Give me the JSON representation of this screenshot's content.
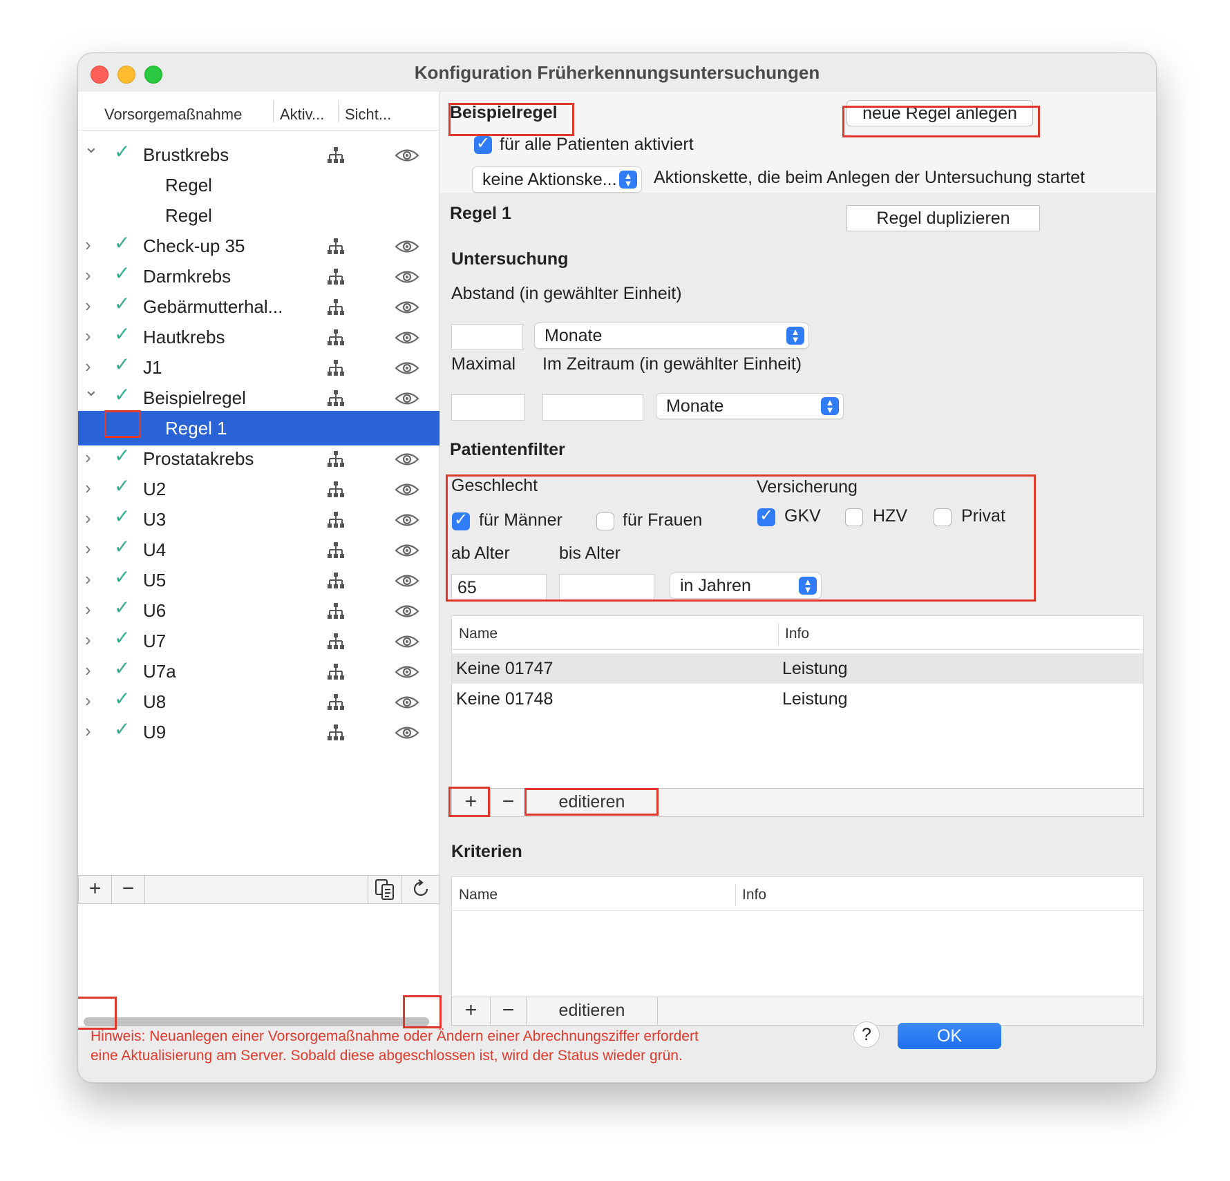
{
  "window": {
    "title": "Konfiguration Früherkennungsuntersuchungen"
  },
  "sidebar": {
    "columns": [
      "Vorsorgemaßnahme",
      "Aktiv...",
      "Sicht..."
    ],
    "items": [
      {
        "label": "Brustkrebs",
        "expanded": true,
        "checked": true
      },
      {
        "label": "Regel",
        "child": true
      },
      {
        "label": "Regel",
        "child": true
      },
      {
        "label": "Check-up 35",
        "checked": true
      },
      {
        "label": "Darmkrebs",
        "checked": true
      },
      {
        "label": "Gebärmutterhal...",
        "checked": true
      },
      {
        "label": "Hautkrebs",
        "checked": true
      },
      {
        "label": "J1",
        "checked": true
      },
      {
        "label": "Beispielregel",
        "expanded": true,
        "checked": true
      },
      {
        "label": "Regel 1",
        "child": true,
        "selected": true
      },
      {
        "label": "Prostatakrebs",
        "checked": true
      },
      {
        "label": "U2",
        "checked": true
      },
      {
        "label": "U3",
        "checked": true
      },
      {
        "label": "U4",
        "checked": true
      },
      {
        "label": "U5",
        "checked": true
      },
      {
        "label": "U6",
        "checked": true
      },
      {
        "label": "U7",
        "checked": true
      },
      {
        "label": "U7a",
        "checked": true
      },
      {
        "label": "U8",
        "checked": true
      },
      {
        "label": "U9",
        "checked": true
      }
    ],
    "bottom": {
      "add": "+",
      "remove": "−"
    }
  },
  "main": {
    "rule_name": "Beispielregel",
    "new_rule_button": "neue Regel anlegen",
    "all_patients_label": "für alle Patienten aktiviert",
    "action_chain_select": "keine Aktionske...",
    "action_chain_label": "Aktionskette, die beim Anlegen der Untersuchung startet",
    "rule_title": "Regel 1",
    "duplicate_button": "Regel duplizieren",
    "untersuchung": {
      "heading": "Untersuchung",
      "abstand_label": "Abstand (in gewählter Einheit)",
      "abstand_value": "",
      "abstand_unit": "Monate",
      "maximal_label": "Maximal",
      "zeitraum_label": "Im Zeitraum (in gewählter Einheit)",
      "maximal_value": "",
      "zeitraum_value": "",
      "zeitraum_unit": "Monate"
    },
    "patientenfilter": {
      "heading": "Patientenfilter",
      "geschlecht_label": "Geschlecht",
      "maenner_label": "für Männer",
      "frauen_label": "für Frauen",
      "versicherung_label": "Versicherung",
      "gkv_label": "GKV",
      "hzv_label": "HZV",
      "privat_label": "Privat",
      "ab_alter_label": "ab Alter",
      "bis_alter_label": "bis Alter",
      "ab_alter_value": "65",
      "bis_alter_value": "",
      "alter_unit": "in Jahren"
    },
    "leistungen_table": {
      "columns": [
        "Name",
        "Info"
      ],
      "rows": [
        {
          "name": "Keine 01747",
          "info": "Leistung"
        },
        {
          "name": "Keine 01748",
          "info": "Leistung"
        }
      ],
      "add": "+",
      "remove": "−",
      "edit": "editieren"
    },
    "kriterien": {
      "heading": "Kriterien",
      "columns": [
        "Name",
        "Info"
      ],
      "add": "+",
      "remove": "−",
      "edit": "editieren"
    },
    "hint_line1": "Hinweis: Neuanlegen einer Vorsorgemaßnahme oder Ändern einer Abrechnungsziffer erfordert",
    "hint_line2": "eine Aktualisierung am Server. Sobald diese abgeschlossen ist, wird der Status wieder grün.",
    "help_button": "?",
    "ok_button": "OK"
  },
  "colors": {
    "accent": "#2f7cf6",
    "selection": "#2a63d6",
    "check_green": "#3aae8a",
    "highlight_red": "#e0392b"
  }
}
